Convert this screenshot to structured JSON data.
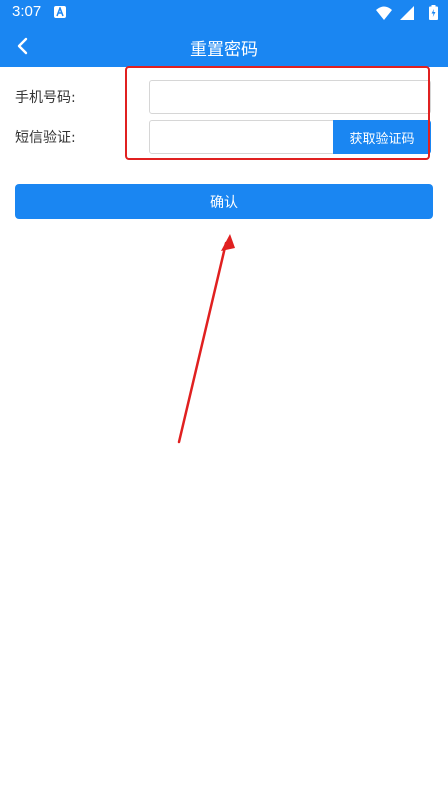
{
  "status_bar": {
    "time": "3:07",
    "icons": [
      "notification-a-icon",
      "wifi-icon",
      "signal-icon",
      "battery-icon"
    ]
  },
  "app_bar": {
    "title": "重置密码",
    "back_icon": "chevron-left-icon"
  },
  "form": {
    "phone_label": "手机号码:",
    "phone_value": "",
    "sms_label": "短信验证:",
    "sms_value": "",
    "get_code_label": "获取验证码"
  },
  "confirm_label": "确认",
  "colors": {
    "primary": "#1a86f2",
    "annotation": "#e02020",
    "border": "#d6d6d6",
    "text": "#333333"
  }
}
